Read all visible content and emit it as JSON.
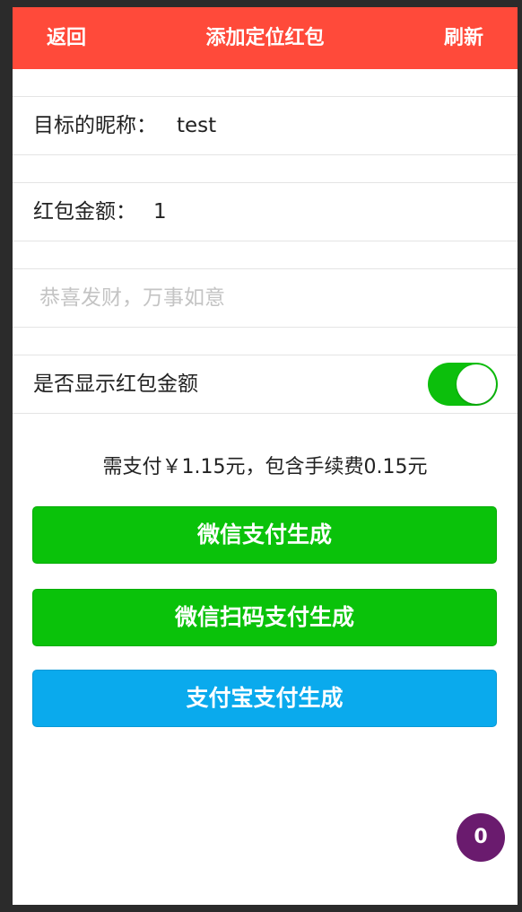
{
  "header": {
    "back_label": "返回",
    "title": "添加定位红包",
    "refresh_label": "刷新"
  },
  "form": {
    "nickname_label": "目标的昵称：",
    "nickname_value": "test",
    "amount_label": "红包金额：",
    "amount_value": "1",
    "message_placeholder": "恭喜发财，万事如意",
    "show_amount_label": "是否显示红包金额",
    "show_amount_enabled": true
  },
  "payment": {
    "notice": "需支付￥1.15元，包含手续费0.15元",
    "wechat_pay_label": "微信支付生成",
    "wechat_scan_label": "微信扫码支付生成",
    "alipay_label": "支付宝支付生成"
  },
  "badge": {
    "count": "0"
  },
  "colors": {
    "header": "#ff4a3a",
    "toggle_on": "#0cbf0c",
    "wechat_green": "#0ac20a",
    "alipay_blue": "#0aaaed",
    "badge": "#6a1b6e"
  }
}
